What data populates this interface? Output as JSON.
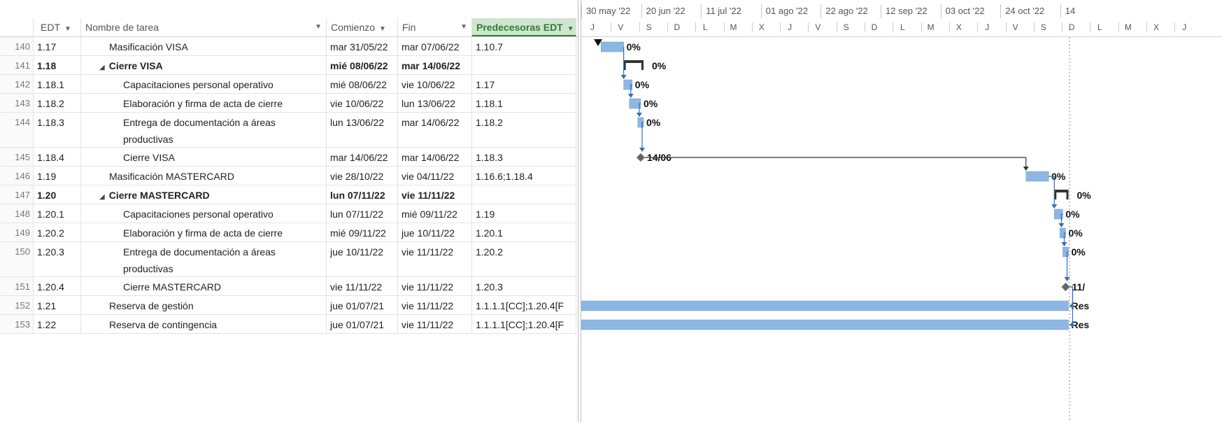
{
  "table": {
    "headers": {
      "edt": "EDT",
      "name": "Nombre de tarea",
      "start": "Comienzo",
      "end": "Fin",
      "pred": "Predecesoras EDT"
    },
    "rows": [
      {
        "id": "140",
        "edt": "1.17",
        "name": "Masificación VISA",
        "start": "mar 31/05/22",
        "end": "mar 07/06/22",
        "pred": "1.10.7",
        "level": 1,
        "summary": false
      },
      {
        "id": "141",
        "edt": "1.18",
        "name": "Cierre VISA",
        "start": "mié 08/06/22",
        "end": "mar 14/06/22",
        "pred": "",
        "level": 1,
        "summary": true
      },
      {
        "id": "142",
        "edt": "1.18.1",
        "name": "Capacitaciones personal operativo",
        "start": "mié 08/06/22",
        "end": "vie 10/06/22",
        "pred": "1.17",
        "level": 2,
        "summary": false
      },
      {
        "id": "143",
        "edt": "1.18.2",
        "name": "Elaboración y firma de acta de cierre",
        "start": "vie 10/06/22",
        "end": "lun 13/06/22",
        "pred": "1.18.1",
        "level": 2,
        "summary": false
      },
      {
        "id": "144",
        "edt": "1.18.3",
        "name": "Entrega de documentación a áreas productivas",
        "start": "lun 13/06/22",
        "end": "mar 14/06/22",
        "pred": "1.18.2",
        "level": 2,
        "summary": false
      },
      {
        "id": "145",
        "edt": "1.18.4",
        "name": "Cierre VISA",
        "start": "mar 14/06/22",
        "end": "mar 14/06/22",
        "pred": "1.18.3",
        "level": 2,
        "summary": false
      },
      {
        "id": "146",
        "edt": "1.19",
        "name": "Masificación MASTERCARD",
        "start": "vie 28/10/22",
        "end": "vie 04/11/22",
        "pred": "1.16.6;1.18.4",
        "level": 1,
        "summary": false
      },
      {
        "id": "147",
        "edt": "1.20",
        "name": "Cierre MASTERCARD",
        "start": "lun 07/11/22",
        "end": "vie 11/11/22",
        "pred": "",
        "level": 1,
        "summary": true
      },
      {
        "id": "148",
        "edt": "1.20.1",
        "name": "Capacitaciones personal operativo",
        "start": "lun 07/11/22",
        "end": "mié 09/11/22",
        "pred": "1.19",
        "level": 2,
        "summary": false
      },
      {
        "id": "149",
        "edt": "1.20.2",
        "name": "Elaboración y firma de acta de cierre",
        "start": "mié 09/11/22",
        "end": "jue 10/11/22",
        "pred": "1.20.1",
        "level": 2,
        "summary": false
      },
      {
        "id": "150",
        "edt": "1.20.3",
        "name": "Entrega de documentación a áreas productivas",
        "start": "jue 10/11/22",
        "end": "vie 11/11/22",
        "pred": "1.20.2",
        "level": 2,
        "summary": false
      },
      {
        "id": "151",
        "edt": "1.20.4",
        "name": "Cierre MASTERCARD",
        "start": "vie 11/11/22",
        "end": "vie 11/11/22",
        "pred": "1.20.3",
        "level": 2,
        "summary": false
      },
      {
        "id": "152",
        "edt": "1.21",
        "name": "Reserva de gestión",
        "start": "jue 01/07/21",
        "end": "vie 11/11/22",
        "pred": "1.1.1.1[CC];1.20.4[F",
        "level": 1,
        "summary": false
      },
      {
        "id": "153",
        "edt": "1.22",
        "name": "Reserva de contingencia",
        "start": "jue 01/07/21",
        "end": "vie 11/11/22",
        "pred": "1.1.1.1[CC];1.20.4[F",
        "level": 1,
        "summary": false
      }
    ]
  },
  "timescale": {
    "major": [
      "30 may '22",
      "20 jun '22",
      "11 jul '22",
      "01 ago '22",
      "22 ago '22",
      "12 sep '22",
      "03 oct '22",
      "24 oct '22",
      "14"
    ],
    "minor": [
      "J",
      "V",
      "S",
      "D",
      "L",
      "M",
      "X",
      "J",
      "V",
      "S",
      "D",
      "L",
      "M",
      "X",
      "J",
      "V",
      "S",
      "D",
      "L",
      "M",
      "X",
      "J"
    ]
  },
  "gantt": {
    "axis_start": "2022-05-26",
    "tasks": [
      {
        "row": "140",
        "kind": "bar",
        "start": "2022-05-31",
        "end": "2022-06-08",
        "label": "0%"
      },
      {
        "row": "141",
        "kind": "summary",
        "start": "2022-06-08",
        "end": "2022-06-15",
        "label": "0%"
      },
      {
        "row": "142",
        "kind": "bar",
        "start": "2022-06-08",
        "end": "2022-06-11",
        "label": "0%"
      },
      {
        "row": "143",
        "kind": "bar",
        "start": "2022-06-10",
        "end": "2022-06-14",
        "label": "0%"
      },
      {
        "row": "144",
        "kind": "bar",
        "start": "2022-06-13",
        "end": "2022-06-15",
        "label": "0%"
      },
      {
        "row": "145",
        "kind": "milestone",
        "start": "2022-06-14",
        "end": "2022-06-14",
        "label": "14/06"
      },
      {
        "row": "146",
        "kind": "bar",
        "start": "2022-10-28",
        "end": "2022-11-05",
        "label": "0%"
      },
      {
        "row": "147",
        "kind": "summary",
        "start": "2022-11-07",
        "end": "2022-11-12",
        "label": "0%"
      },
      {
        "row": "148",
        "kind": "bar",
        "start": "2022-11-07",
        "end": "2022-11-10",
        "label": "0%"
      },
      {
        "row": "149",
        "kind": "bar",
        "start": "2022-11-09",
        "end": "2022-11-11",
        "label": "0%"
      },
      {
        "row": "150",
        "kind": "bar",
        "start": "2022-11-10",
        "end": "2022-11-12",
        "label": "0%"
      },
      {
        "row": "151",
        "kind": "milestone",
        "start": "2022-11-11",
        "end": "2022-11-11",
        "label": "11/"
      },
      {
        "row": "152",
        "kind": "bar",
        "start": "2021-07-01",
        "end": "2022-11-12",
        "label": "Res"
      },
      {
        "row": "153",
        "kind": "bar",
        "start": "2021-07-01",
        "end": "2022-11-12",
        "label": "Res"
      }
    ],
    "links": [
      {
        "from": "140",
        "to": "142"
      },
      {
        "from": "142",
        "to": "143"
      },
      {
        "from": "143",
        "to": "144"
      },
      {
        "from": "144",
        "to": "145"
      },
      {
        "from": "145",
        "to": "146"
      },
      {
        "from": "146",
        "to": "148"
      },
      {
        "from": "148",
        "to": "149"
      },
      {
        "from": "149",
        "to": "150"
      },
      {
        "from": "150",
        "to": "151"
      },
      {
        "from": "151",
        "to": "152"
      },
      {
        "from": "151",
        "to": "153"
      }
    ],
    "colors": {
      "bar": "#8db7e2",
      "bar_edge": "#6b9bd0",
      "link": "#2f6fb5",
      "summary": "#333333",
      "milestone": "#666666",
      "marker": "#111111"
    }
  }
}
